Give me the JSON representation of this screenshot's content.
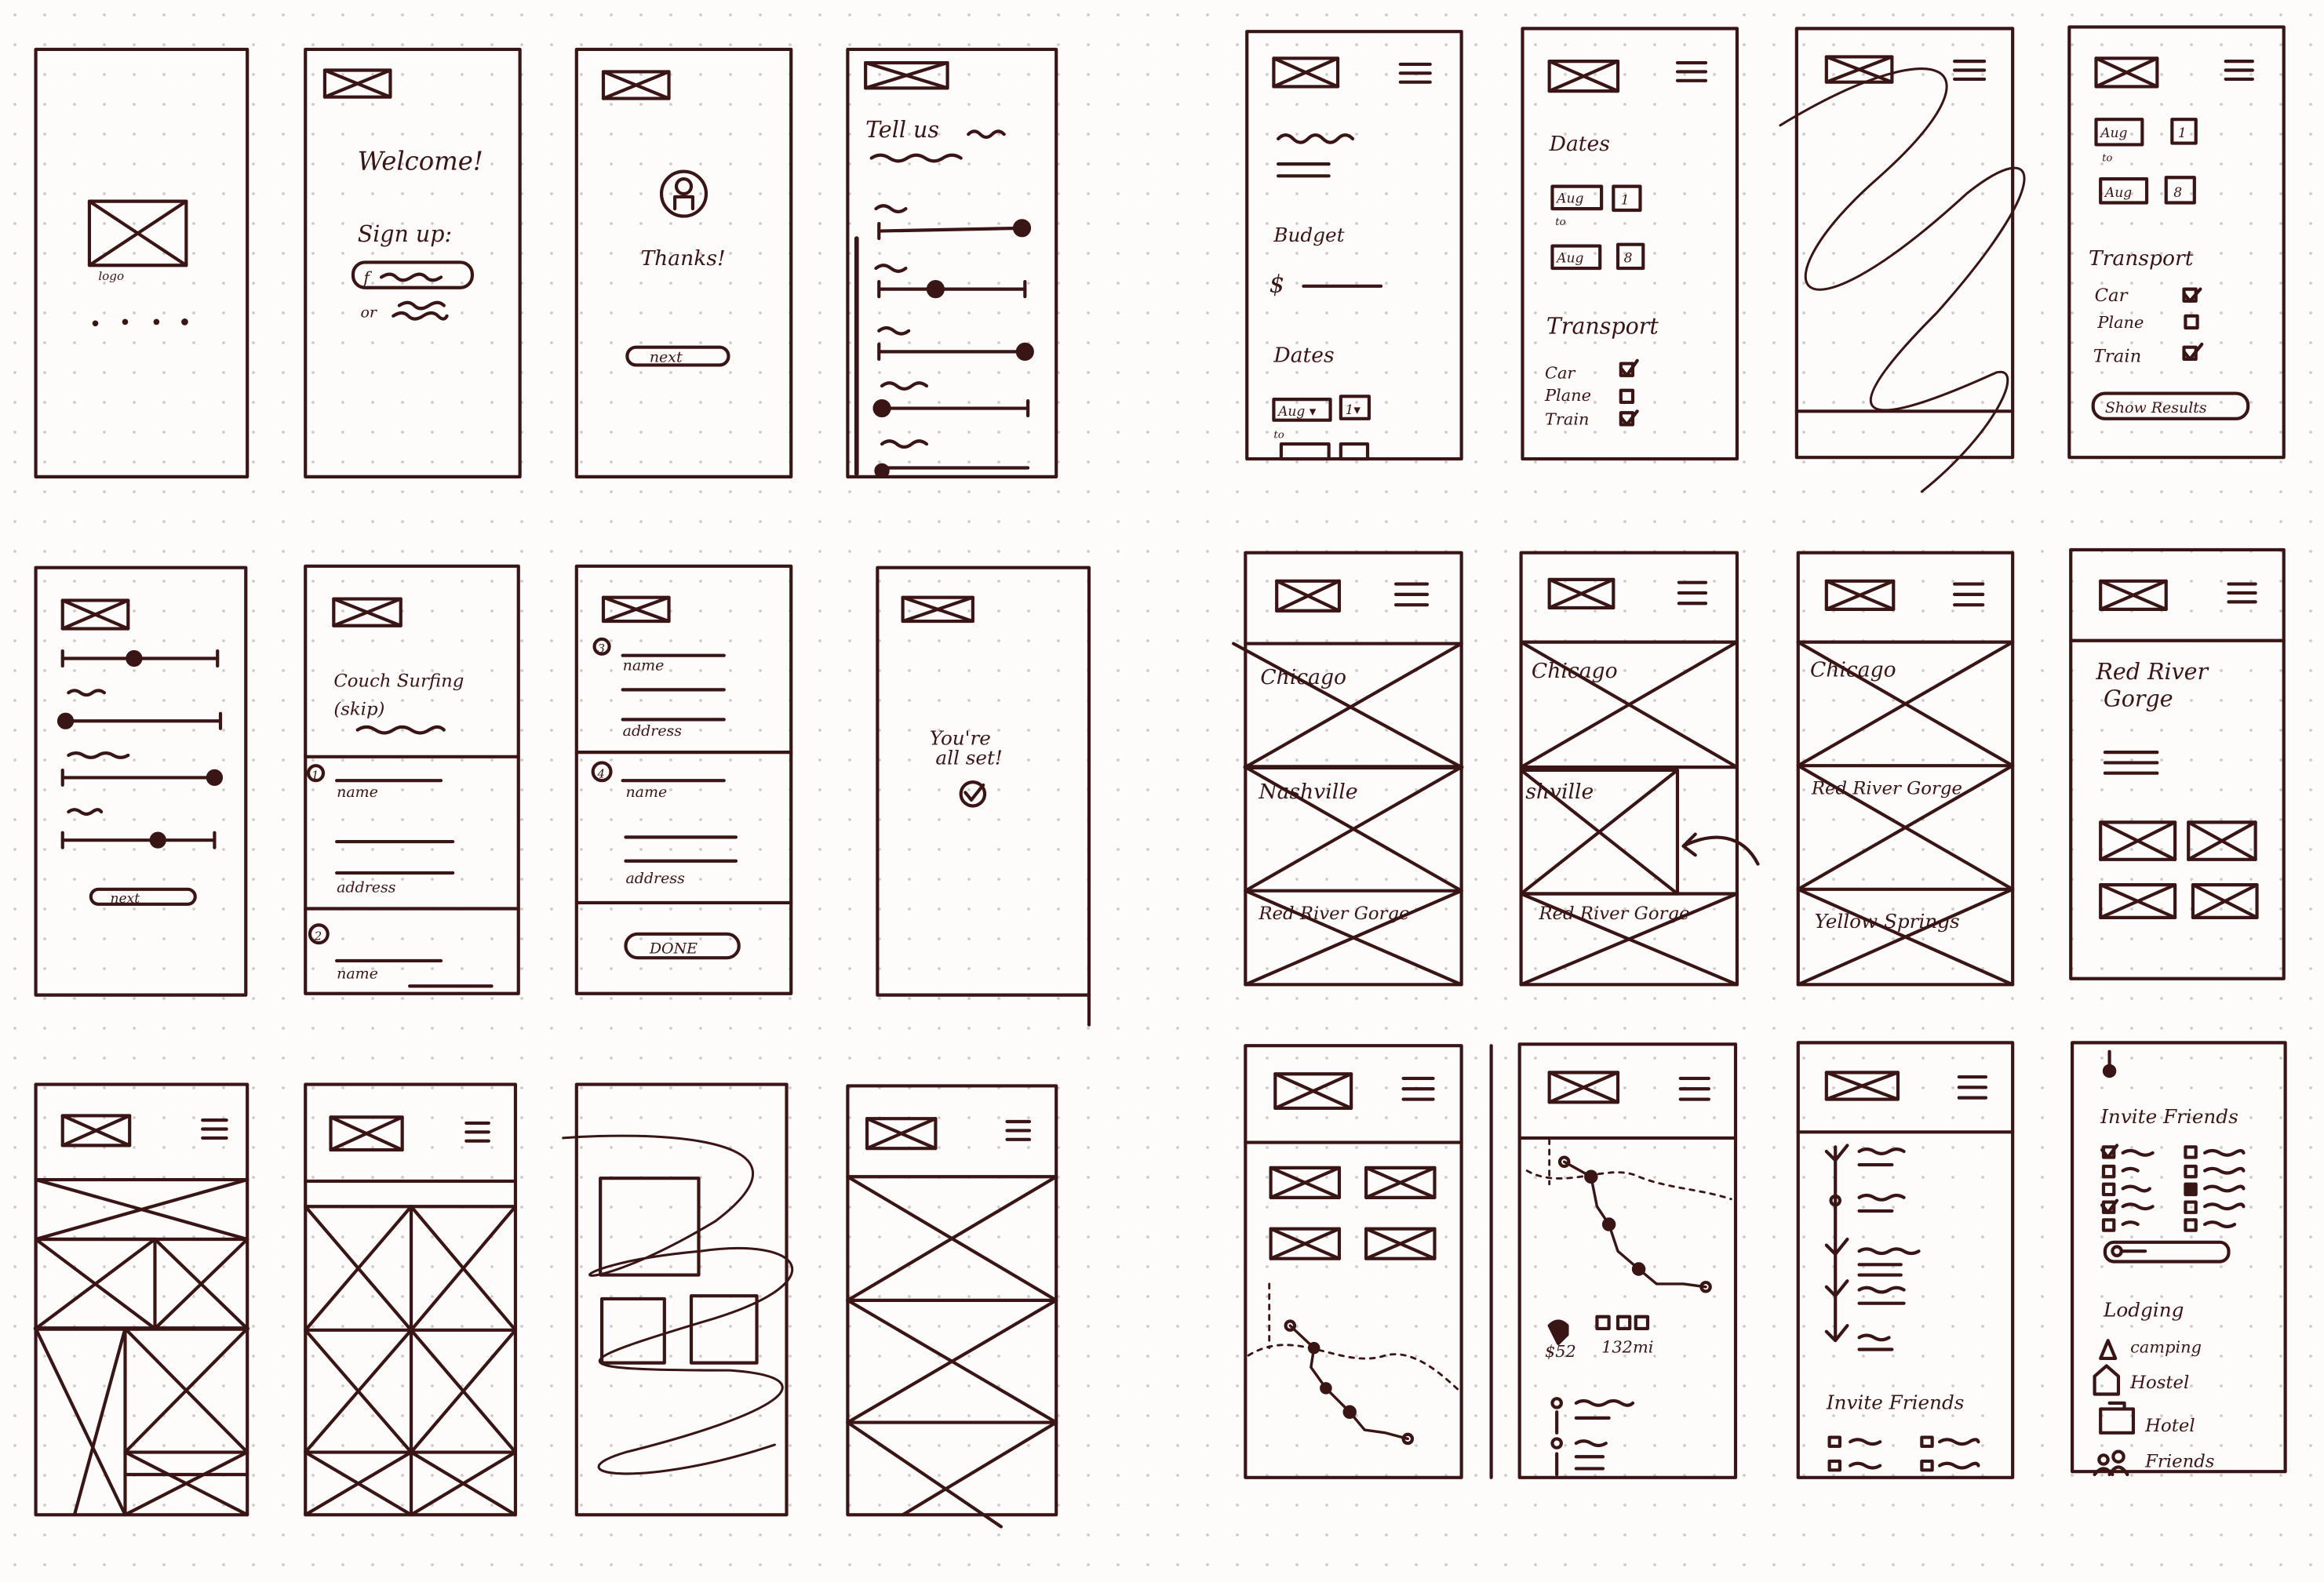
{
  "colors": {
    "ink": "#3a1515",
    "paper": "#fdfcfb",
    "dots": "#cfcac8"
  },
  "onboarding": {
    "logo_caption": "logo",
    "welcome": "Welcome!",
    "sign_up": "Sign up:",
    "fb_glyph": "f",
    "or": "or",
    "thanks": "Thanks!",
    "next": "next",
    "tell_us": "Tell us",
    "couch_surfing": "Couch Surfing",
    "skip": "(skip)",
    "name": "name",
    "address": "address",
    "n1": "1",
    "n2": "2",
    "n3": "3",
    "n4": "4",
    "done": "DONE",
    "all_set_1": "You're",
    "all_set_2": "all set!"
  },
  "planning": {
    "budget": "Budget",
    "dollar": "$",
    "dates": "Dates",
    "aug": "Aug",
    "aug_dd": "Aug ▾",
    "d1": "1",
    "d1_dd": "1▾",
    "d8": "8",
    "to": "to",
    "transport": "Transport",
    "car": "Car",
    "plane": "Plane",
    "train": "Train",
    "show_results": "Show Results"
  },
  "results": {
    "chicago": "Chicago",
    "nashville": "Nashville",
    "nashville_swiped": "shville",
    "red_river_gorge": "Red River Gorge",
    "yellow_springs": "Yellow Springs",
    "detail_title_1": "Red River",
    "detail_title_2": "Gorge"
  },
  "trip": {
    "cost": "$52",
    "distance": "132mi",
    "invite_friends": "Invite Friends",
    "lodging": "Lodging",
    "camping": "camping",
    "hostel": "Hostel",
    "hotel": "Hotel",
    "friends": "Friends"
  }
}
